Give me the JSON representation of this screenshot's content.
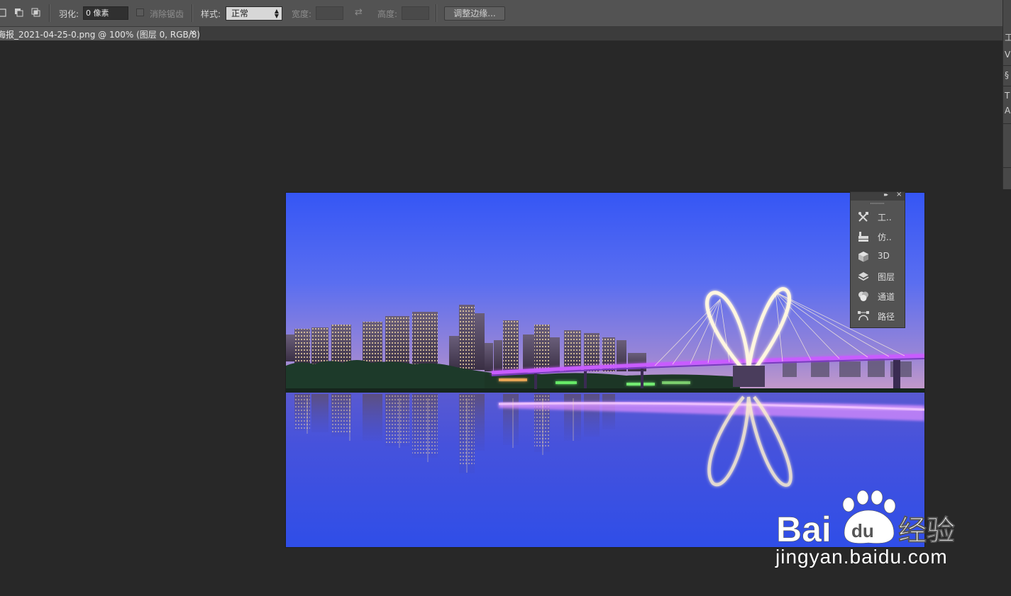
{
  "options_bar": {
    "feather_label": "羽化:",
    "feather_value": "0 像素",
    "antialias_label": "消除锯齿",
    "style_label": "样式:",
    "style_value": "正常",
    "width_label": "宽度:",
    "width_value": "",
    "height_label": "高度:",
    "height_value": "",
    "refine_edge_button": "调整边缘..."
  },
  "document_tab": {
    "title": "海报_2021-04-25-0.png @ 100% (图层 0, RGB/8)",
    "close": "×"
  },
  "right_strip": {
    "glyphs": [
      "工",
      "V",
      "§",
      "T",
      "A"
    ]
  },
  "floating_panel": {
    "expand": "▸▸",
    "close": "×",
    "items": [
      {
        "label": "工..",
        "icon": "tools-icon"
      },
      {
        "label": "仿..",
        "icon": "clone-source-icon"
      },
      {
        "label": "3D",
        "icon": "3d-cube-icon"
      },
      {
        "label": "图层",
        "icon": "layers-icon"
      },
      {
        "label": "通道",
        "icon": "channels-icon"
      },
      {
        "label": "路径",
        "icon": "paths-icon"
      }
    ]
  },
  "watermark": {
    "logo_text": "Bai du 经验",
    "url": "jingyan.baidu.com"
  },
  "colors": {
    "sky_top": "#3a5cf5",
    "sky_bottom": "#8a7bd8",
    "water": "#3d55e0",
    "bridge_light": "#b04cf0",
    "ui_dark": "#282828",
    "ui_mid": "#535353"
  }
}
